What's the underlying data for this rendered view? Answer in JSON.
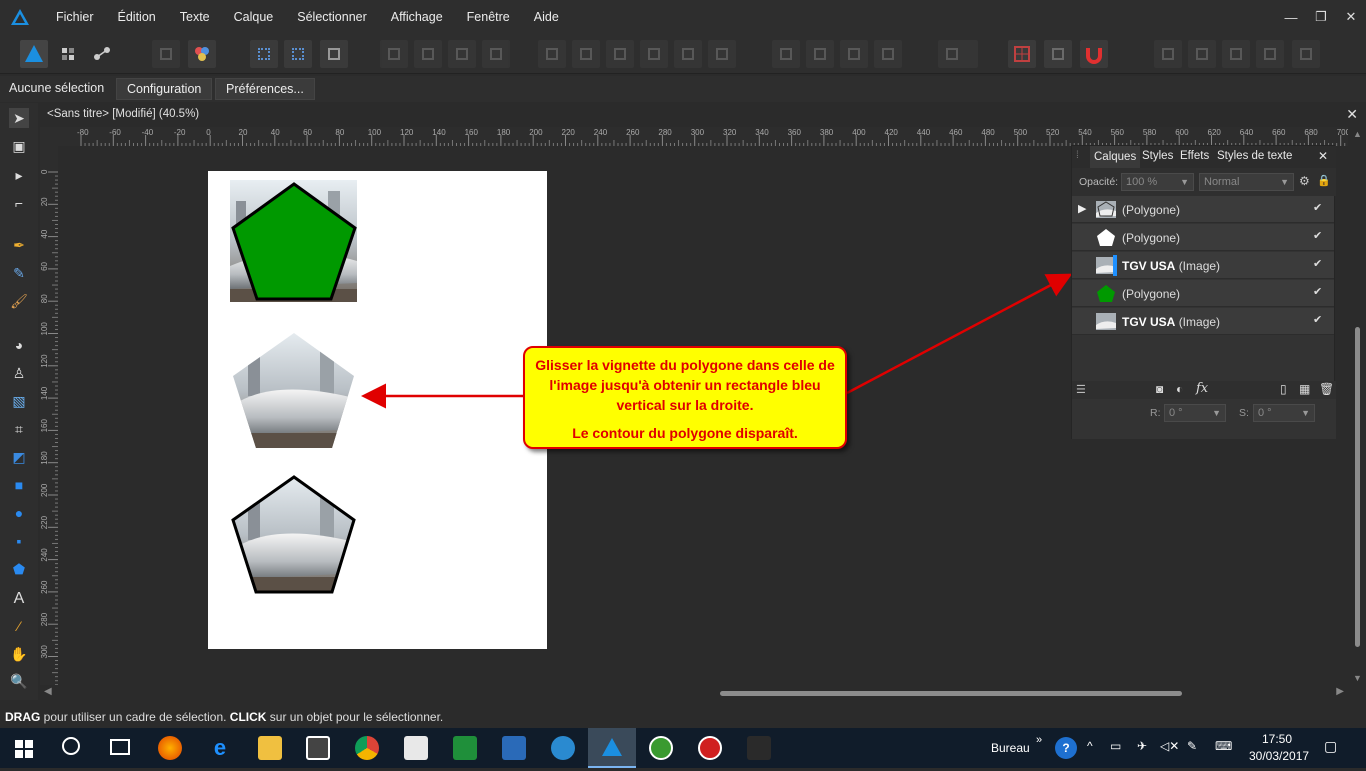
{
  "menubar": {
    "items": [
      "Fichier",
      "Édition",
      "Texte",
      "Calque",
      "Sélectionner",
      "Affichage",
      "Fenêtre",
      "Aide"
    ]
  },
  "context": {
    "label": "Aucune sélection",
    "buttons": [
      "Configuration",
      "Préférences..."
    ]
  },
  "document": {
    "title": "<Sans titre> [Modifié] (40.5%)"
  },
  "ruler": {
    "h_ticks": [
      "-80",
      "-60",
      "-40",
      "-20",
      "0",
      "20",
      "40",
      "60",
      "80",
      "100",
      "120",
      "140",
      "160",
      "180",
      "200",
      "220",
      "240",
      "260",
      "280",
      "300",
      "320",
      "340",
      "360",
      "380",
      "400",
      "420",
      "440",
      "460",
      "480",
      "500",
      "520",
      "540",
      "560",
      "580",
      "600",
      "620",
      "640",
      "660",
      "680",
      "700"
    ],
    "v_ticks": [
      "0",
      "20",
      "40",
      "60",
      "80",
      "100",
      "120",
      "140",
      "160",
      "180",
      "200",
      "220",
      "240",
      "260",
      "280",
      "300"
    ]
  },
  "panel": {
    "tabs": [
      "Calques",
      "Styles",
      "Effets",
      "Styles de texte"
    ],
    "opacity_label": "Opacité:",
    "opacity_value": "100 %",
    "blend_mode": "Normal",
    "layers": [
      {
        "name": "",
        "type": "(Polygone)",
        "expandable": true,
        "thumb": "photo-polygon"
      },
      {
        "name": "",
        "type": "(Polygone)",
        "expandable": false,
        "thumb": "white-pentagon"
      },
      {
        "name": "TGV USA",
        "type": "(Image)",
        "expandable": false,
        "thumb": "photo"
      },
      {
        "name": "",
        "type": "(Polygone)",
        "expandable": false,
        "thumb": "green-pentagon"
      },
      {
        "name": "TGV USA",
        "type": "(Image)",
        "expandable": false,
        "thumb": "photo"
      }
    ],
    "r_label": "R:",
    "r_value": "0 °",
    "s_label": "S:",
    "s_value": "0 °"
  },
  "callout": {
    "line1": "Glisser la vignette du polygone dans celle de l'image jusqu'à obtenir un rectangle bleu vertical sur la droite.",
    "line2": "Le contour du polygone disparaît."
  },
  "status": {
    "drag": "DRAG",
    "drag_text": " pour utiliser un cadre de sélection. ",
    "click": "CLICK",
    "click_text": " sur un objet pour le sélectionner."
  },
  "taskbar": {
    "desktop_label": "Bureau",
    "time": "17:50",
    "date": "30/03/2017"
  },
  "colors": {
    "accent": "#1e90ff",
    "pentagon_green": "#009900",
    "callout_bg": "#ffff00",
    "callout_text": "#e00000"
  }
}
